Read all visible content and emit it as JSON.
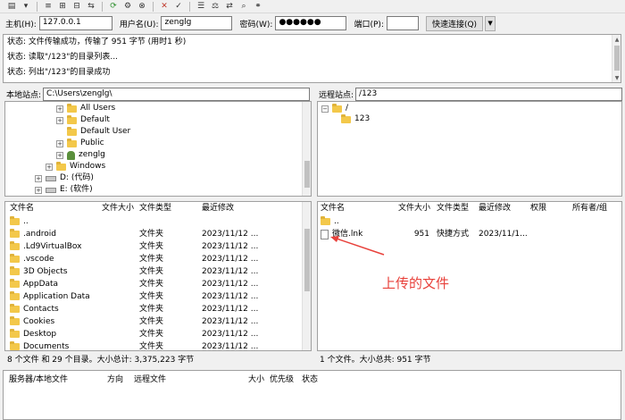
{
  "colors": {
    "annotation": "#e8413b",
    "folder": "#f3c84a",
    "window_bg": "#f0f0f0"
  },
  "toolbar": {
    "icons": [
      "site-manager-icon",
      "toggle-log-icon",
      "toggle-tree-icon",
      "toggle-remote-icon",
      "toggle-queue-icon",
      "refresh-icon",
      "process-queue-icon",
      "cancel-icon",
      "disconnect-icon",
      "reconnect-icon",
      "filter-icon",
      "compare-icon",
      "sync-browse-icon",
      "search-icon",
      "binoculars-icon"
    ]
  },
  "quickconnect": {
    "host_label": "主机(H):",
    "host_value": "127.0.0.1",
    "user_label": "用户名(U):",
    "user_value": "zenglg",
    "password_label": "密码(W):",
    "password_value": "●●●●●●",
    "port_label": "端口(P):",
    "port_value": "",
    "connect_button": "快速连接(Q)",
    "dropdown": "▼"
  },
  "log": {
    "lines": [
      "状态: 文件传输成功，传输了 951 字节 (用时1 秒)",
      "状态: 读取\"/123\"的目录列表...",
      "状态: 列出\"/123\"的目录成功"
    ]
  },
  "local": {
    "path_label": "本地站点:",
    "path_value": "C:\\Users\\zenglg\\",
    "tree": [
      "All Users",
      "Default",
      "Default User",
      "Public",
      "zenglg",
      "Windows",
      "D: (代码)",
      "E: (软件)"
    ],
    "columns": [
      "文件名",
      "文件大小",
      "文件类型",
      "最近修改"
    ],
    "files": [
      {
        "name": "..",
        "type": "",
        "modified": ""
      },
      {
        "name": ".android",
        "type": "文件夹",
        "modified": "2023/11/12 ..."
      },
      {
        "name": ".Ld9VirtualBox",
        "type": "文件夹",
        "modified": "2023/11/12 ..."
      },
      {
        "name": ".vscode",
        "type": "文件夹",
        "modified": "2023/11/12 ..."
      },
      {
        "name": "3D Objects",
        "type": "文件夹",
        "modified": "2023/11/12 ..."
      },
      {
        "name": "AppData",
        "type": "文件夹",
        "modified": "2023/11/12 ..."
      },
      {
        "name": "Application Data",
        "type": "文件夹",
        "modified": "2023/11/12 ..."
      },
      {
        "name": "Contacts",
        "type": "文件夹",
        "modified": "2023/11/12 ..."
      },
      {
        "name": "Cookies",
        "type": "文件夹",
        "modified": "2023/11/12 ..."
      },
      {
        "name": "Desktop",
        "type": "文件夹",
        "modified": "2023/11/12 ..."
      },
      {
        "name": "Documents",
        "type": "文件夹",
        "modified": "2023/11/12 ..."
      }
    ],
    "status": "8 个文件 和 29 个目录。大小总计: 3,375,223 字节"
  },
  "remote": {
    "path_label": "远程站点:",
    "path_value": "/123",
    "tree": [
      "/",
      "123"
    ],
    "columns": [
      "文件名",
      "文件大小",
      "文件类型",
      "最近修改",
      "权限",
      "所有者/组"
    ],
    "files": [
      {
        "name": "..",
        "size": "",
        "type": "",
        "modified": ""
      },
      {
        "name": "微信.lnk",
        "size": "951",
        "type": "快捷方式",
        "modified": "2023/11/1..."
      }
    ],
    "status": "1 个文件。大小总共: 951 字节"
  },
  "queue": {
    "columns": [
      "服务器/本地文件",
      "方向",
      "远程文件",
      "大小",
      "优先级",
      "状态"
    ]
  },
  "annotation": {
    "text": "上传的文件"
  }
}
